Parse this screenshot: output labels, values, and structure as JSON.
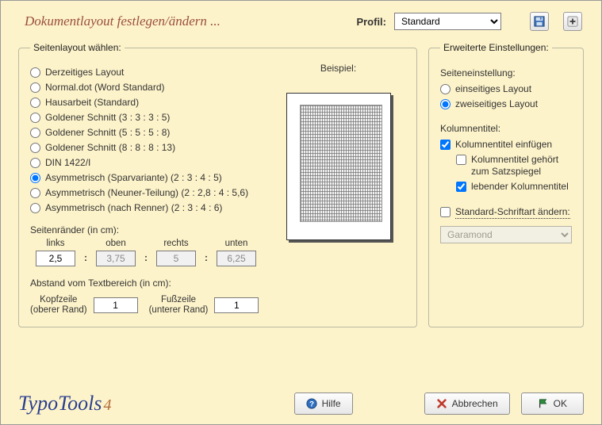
{
  "header": {
    "title": "Dokumentlayout festlegen/ändern ...",
    "profil_label": "Profil:",
    "profil_value": "Standard"
  },
  "layout_group": {
    "legend": "Seitenlayout wählen:",
    "options": [
      "Derzeitiges Layout",
      "Normal.dot (Word Standard)",
      "Hausarbeit (Standard)",
      "Goldener Schnitt (3 : 3 : 3 : 5)",
      "Goldener Schnitt (5 : 5 : 5 : 8)",
      "Goldener Schnitt (8 : 8 : 8 : 13)",
      "DIN 1422/I",
      "Asymmetrisch (Sparvariante) (2 : 3 : 4 : 5)",
      "Asymmetrisch (Neuner-Teilung) (2 : 2,8 : 4 : 5,6)",
      "Asymmetrisch (nach Renner) (2 : 3 : 4 : 6)"
    ],
    "selected_index": 7,
    "example_label": "Beispiel:"
  },
  "margins": {
    "section_label": "Seitenränder (in cm):",
    "links_label": "links",
    "links_value": "2,5",
    "oben_label": "oben",
    "oben_value": "3,75",
    "rechts_label": "rechts",
    "rechts_value": "5",
    "unten_label": "unten",
    "unten_value": "6,25"
  },
  "hf": {
    "section_label": "Abstand vom Textbereich (in cm):",
    "kopf_label": "Kopfzeile\n(oberer Rand)",
    "kopf_value": "1",
    "fuss_label": "Fußzeile\n(unterer Rand)",
    "fuss_value": "1"
  },
  "ext": {
    "legend": "Erweiterte Einstellungen:",
    "seiteneinst_label": "Seiteneinstellung:",
    "einseitig": "einseitiges Layout",
    "zweiseitig": "zweiseitiges Layout",
    "kolumnentitel_label": "Kolumnentitel:",
    "kt_einfuegen": "Kolumnentitel einfügen",
    "kt_satzspiegel": "Kolumnentitel gehört zum Satzspiegel",
    "kt_lebend": "lebender Kolumnentitel",
    "std_schrift": "Standard-Schriftart ändern:",
    "font_value": "Garamond"
  },
  "footer": {
    "brand": "TypoTools",
    "version": "4",
    "hilfe": "Hilfe",
    "abbrechen": "Abbrechen",
    "ok": "OK"
  }
}
